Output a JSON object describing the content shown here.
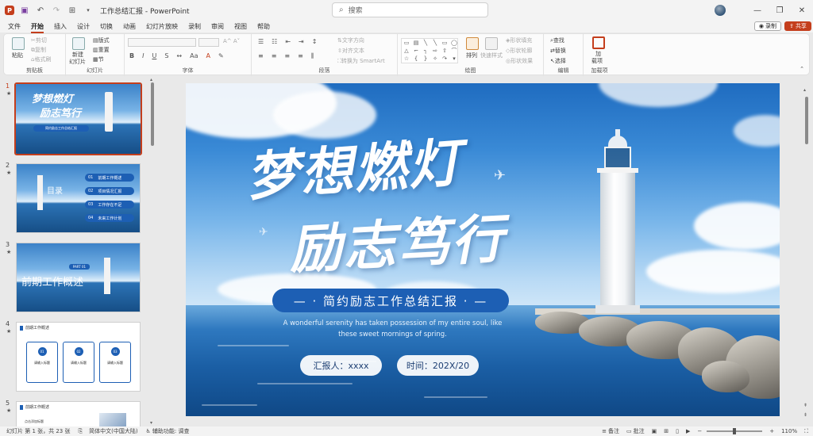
{
  "app": {
    "doc_title": "工作总结汇报",
    "separator": "-",
    "app_name": "PowerPoint",
    "search_placeholder": "搜索"
  },
  "menu": {
    "tabs": [
      "文件",
      "开始",
      "插入",
      "设计",
      "切换",
      "动画",
      "幻灯片放映",
      "录制",
      "审阅",
      "视图",
      "帮助"
    ],
    "active": "开始",
    "record_label": "录制",
    "share_label": "共享"
  },
  "ribbon": {
    "clipboard": {
      "paste": "粘贴",
      "cut": "剪切",
      "copy": "复制",
      "format_painter": "格式刷",
      "label": "剪贴板"
    },
    "slides": {
      "new_slide": "新建",
      "new_slide2": "幻灯片",
      "layout": "版式",
      "reset": "重置",
      "section": "节",
      "label": "幻灯片"
    },
    "font": {
      "label": "字体",
      "bold": "B",
      "italic": "I",
      "underline": "U",
      "strike": "S",
      "aa": "Aa"
    },
    "paragraph": {
      "text_direction": "文字方向",
      "align_text": "对齐文本",
      "smartart": "转换为 SmartArt",
      "label": "段落"
    },
    "drawing": {
      "arrange": "排列",
      "quick_styles": "快速样式",
      "shape_fill": "形状填充",
      "shape_outline": "形状轮廓",
      "shape_effects": "形状效果",
      "label": "绘图"
    },
    "editing": {
      "find": "查找",
      "replace": "替换",
      "select": "选择",
      "label": "编辑"
    },
    "addins": {
      "addin": "加",
      "addin2": "载项",
      "label": "加载项"
    }
  },
  "thumbnails": [
    {
      "num": "1",
      "title1": "梦想燃灯",
      "title2": "励志笃行",
      "pill": "简约励志工作总结汇报"
    },
    {
      "num": "2",
      "heading": "目录",
      "items": [
        {
          "n": "01",
          "t": "前期工作概述"
        },
        {
          "n": "02",
          "t": "项目情况汇报"
        },
        {
          "n": "03",
          "t": "工作存在不足"
        },
        {
          "n": "04",
          "t": "未来工作计划"
        }
      ]
    },
    {
      "num": "3",
      "part": "PART 01",
      "title": "前期工作概述"
    },
    {
      "num": "4",
      "header": "前期工作概述",
      "cards": [
        {
          "n": "01",
          "t": "请输入标题"
        },
        {
          "n": "02",
          "t": "请输入标题"
        },
        {
          "n": "03",
          "t": "请输入标题"
        }
      ]
    },
    {
      "num": "5",
      "header": "前期工作概述",
      "sub": "点击添加标题"
    }
  ],
  "slide": {
    "title_line1": "梦想燃灯",
    "title_line2": "励志笃行",
    "subtitle": "— · 简约励志工作总结汇报 · —",
    "english_line1": "A wonderful serenity has taken possession of my entire soul, like",
    "english_line2": "these sweet mornings of spring.",
    "reporter": "汇报人：xxxx",
    "date": "时间：202X/20"
  },
  "status": {
    "slide_info": "幻灯片 第 1 张，共 23 张",
    "language": "简体中文(中国大陆)",
    "accessibility": "辅助功能: 调查",
    "notes": "备注",
    "comments": "批注",
    "zoom": "110%"
  }
}
